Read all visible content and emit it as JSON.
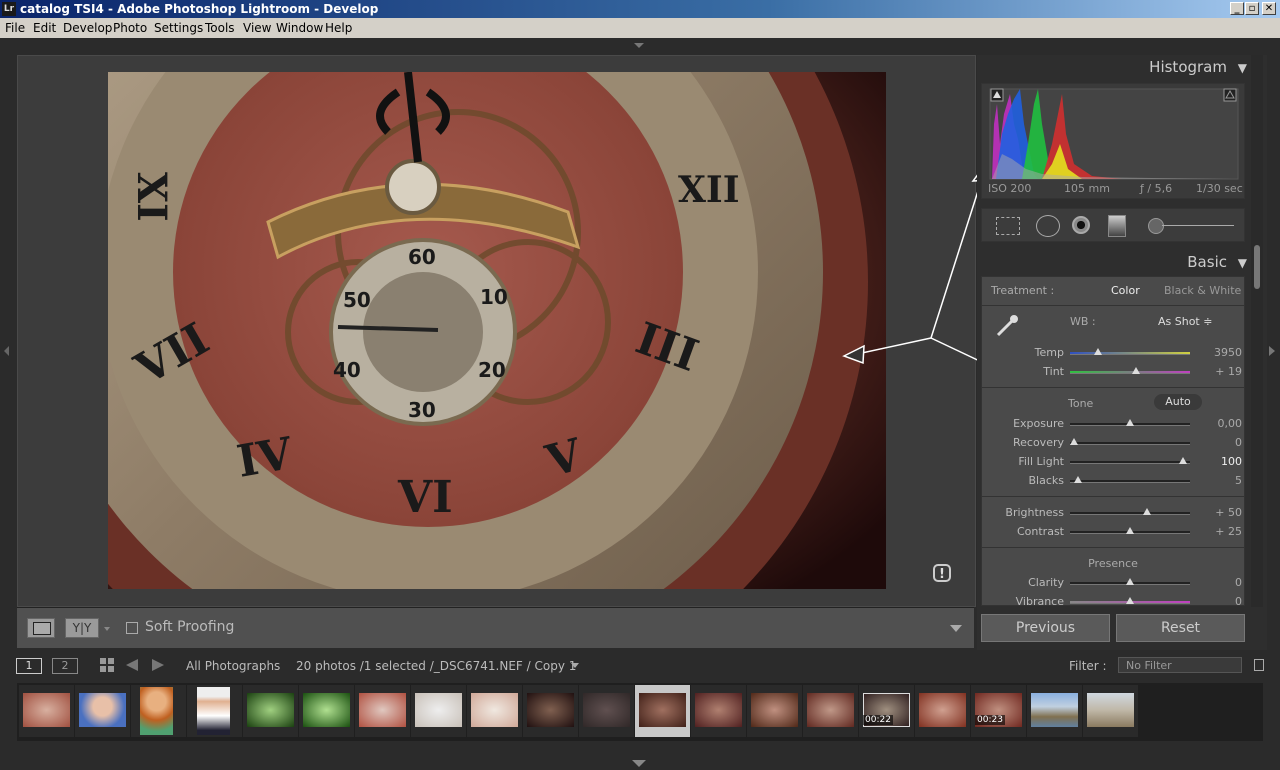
{
  "window": {
    "title": "catalog TSI4 - Adobe Photoshop Lightroom - Develop",
    "app_badge": "Lr",
    "minimize": "_",
    "maximize": "▫",
    "close": "✕"
  },
  "menu": [
    "File",
    "Edit",
    "Develop",
    "Photo",
    "Settings",
    "Tools",
    "View",
    "Window",
    "Help"
  ],
  "histogram": {
    "title": "Histogram",
    "iso": "ISO 200",
    "focal": "105 mm",
    "aperture": "ƒ / 5,6",
    "shutter": "1/30 sec"
  },
  "basic": {
    "title": "Basic",
    "treatment_label": "Treatment :",
    "color_label": "Color",
    "bw_label": "Black & White",
    "wb_label": "WB :",
    "wb_value": "As Shot ≑",
    "temp": {
      "label": "Temp",
      "value": "3950",
      "level": 0.23
    },
    "tint": {
      "label": "Tint",
      "value": "+ 19",
      "level": 0.55
    },
    "tone_label": "Tone",
    "auto_label": "Auto",
    "exposure": {
      "label": "Exposure",
      "value": "0,00",
      "level": 0.5
    },
    "recovery": {
      "label": "Recovery",
      "value": "0",
      "level": 0.03
    },
    "fill_light": {
      "label": "Fill Light",
      "value": "100",
      "level": 0.94
    },
    "blacks": {
      "label": "Blacks",
      "value": "5",
      "level": 0.07
    },
    "brightness": {
      "label": "Brightness",
      "value": "+ 50",
      "level": 0.64
    },
    "contrast": {
      "label": "Contrast",
      "value": "+ 25",
      "level": 0.5
    },
    "presence_label": "Presence",
    "clarity": {
      "label": "Clarity",
      "value": "0",
      "level": 0.5
    },
    "vibrance": {
      "label": "Vibrance",
      "value": "0",
      "level": 0.5
    }
  },
  "toolbar": {
    "soft_proofing": "Soft Proofing",
    "compare_label": "Y|Y"
  },
  "buttons": {
    "previous": "Previous",
    "reset": "Reset"
  },
  "filmbar": {
    "screen1": "1",
    "screen2": "2",
    "source": "All Photographs",
    "info": "20 photos /1 selected /_DSC6741.NEF / Copy 1",
    "filter_label": "Filter :",
    "filter_value": "No Filter"
  },
  "film_badges": {
    "t15": "00:22",
    "t17": "00:23"
  },
  "colors": {
    "accent_panel": "#4a4a4a",
    "titlebar": "#0a246a",
    "background": "#2b2b2b"
  }
}
